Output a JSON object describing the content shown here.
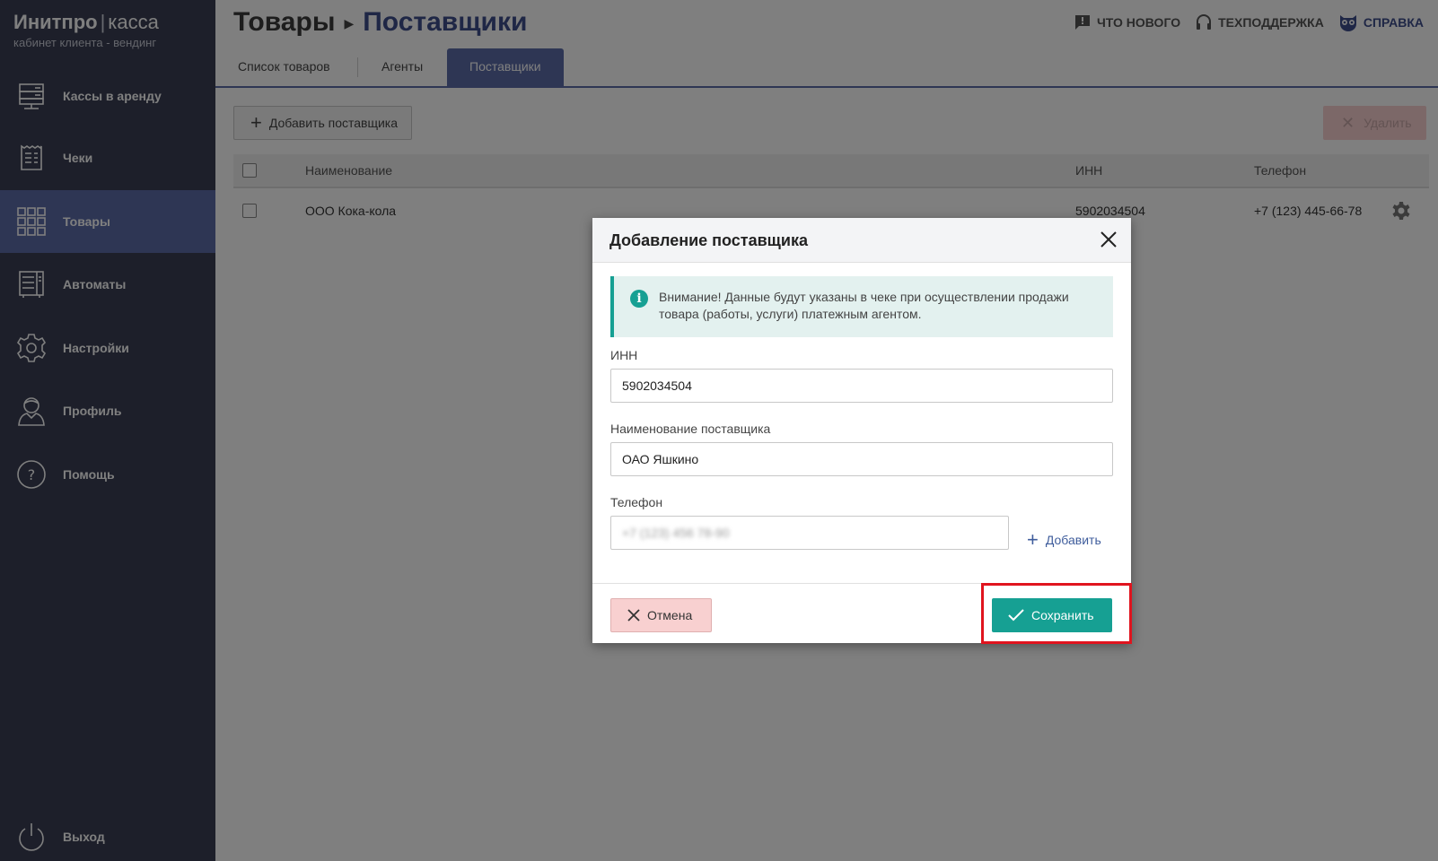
{
  "brand": {
    "name_bold": "Инитпро",
    "separator": "|",
    "name_light": "касса",
    "subtitle": "кабинет клиента - вендинг"
  },
  "sidebar": {
    "items": [
      {
        "label": "Кассы в аренду",
        "icon": "server-icon",
        "active": false
      },
      {
        "label": "Чеки",
        "icon": "receipt-icon",
        "active": false
      },
      {
        "label": "Товары",
        "icon": "grid-icon",
        "active": true
      },
      {
        "label": "Автоматы",
        "icon": "vending-machine-icon",
        "active": false
      },
      {
        "label": "Настройки",
        "icon": "gear-icon",
        "active": false
      },
      {
        "label": "Профиль",
        "icon": "user-icon",
        "active": false
      },
      {
        "label": "Помощь",
        "icon": "question-icon",
        "active": false
      }
    ],
    "logout": {
      "label": "Выход",
      "icon": "power-icon"
    }
  },
  "header": {
    "breadcrumb_root": "Товары",
    "breadcrumb_current": "Поставщики",
    "links": [
      {
        "label": "ЧТО НОВОГО",
        "icon": "comment-alert-icon"
      },
      {
        "label": "ТЕХПОДДЕРЖКА",
        "icon": "headset-icon"
      },
      {
        "label": "СПРАВКА",
        "icon": "owl-icon"
      }
    ]
  },
  "tabs": [
    {
      "label": "Список товаров",
      "active": false
    },
    {
      "label": "Агенты",
      "active": false
    },
    {
      "label": "Поставщики",
      "active": true
    }
  ],
  "toolbar": {
    "add_label": "Добавить поставщика",
    "delete_label": "Удалить"
  },
  "table": {
    "columns": [
      "Наименование",
      "ИНН",
      "Телефон"
    ],
    "rows": [
      {
        "name": "ООО Кока-кола",
        "inn": "5902034504",
        "phone": "+7 (123) 445-66-78"
      }
    ]
  },
  "modal": {
    "title": "Добавление поставщика",
    "alert": "Внимание! Данные будут указаны в чеке при осуществлении продажи товара (работы, услуги) платежным агентом.",
    "fields": {
      "inn_label": "ИНН",
      "inn_value": "5902034504",
      "name_label": "Наименование поставщика",
      "name_value": "ОАО Яшкино",
      "phone_label": "Телефон",
      "phone_value": "+7 (123) 456 78-90",
      "add_phone_label": "Добавить"
    },
    "cancel_label": "Отмена",
    "save_label": "Сохранить"
  },
  "colors": {
    "sidebar_bg": "#3a3f54",
    "accent": "#5d6ca8",
    "title_blue": "#3f4e8c",
    "teal": "#16a093",
    "danger_light": "#f8d0d0",
    "highlight": "#e0141e"
  }
}
